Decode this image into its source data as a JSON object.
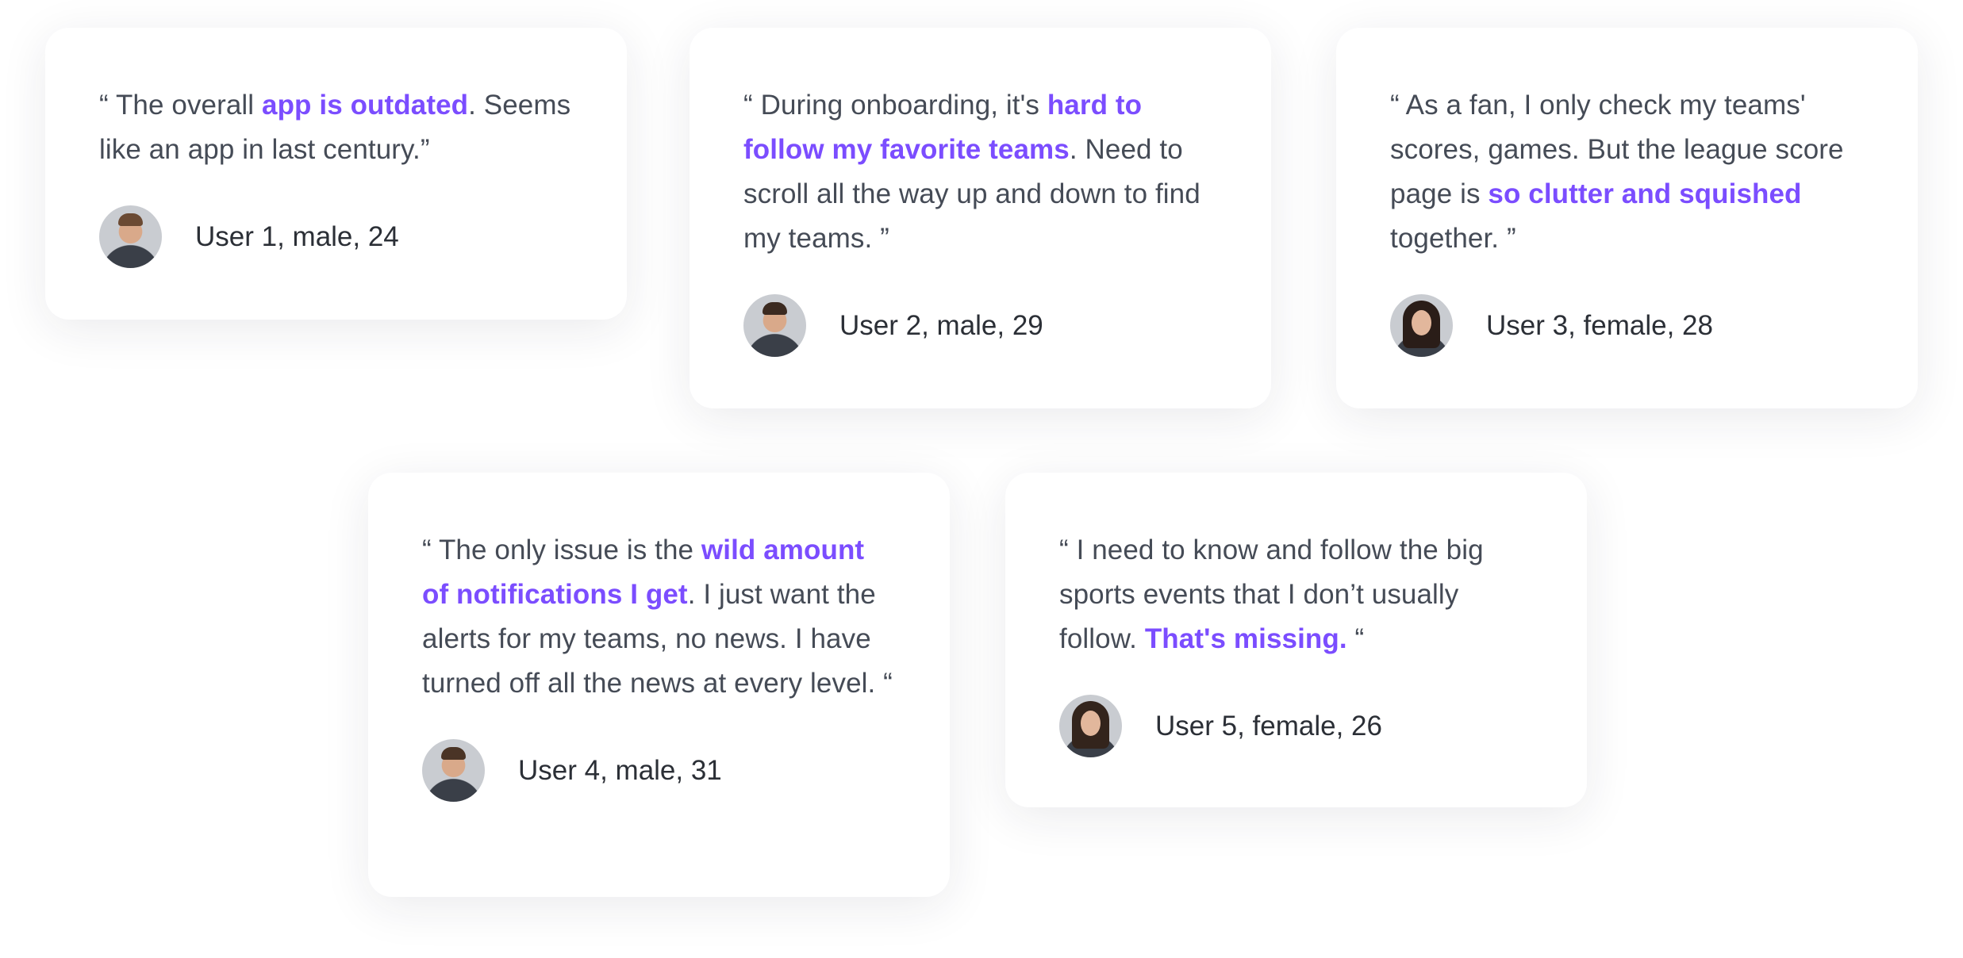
{
  "testimonials": [
    {
      "quote": [
        {
          "text": "“ The overall ",
          "hl": false
        },
        {
          "text": "app is outdated",
          "hl": true
        },
        {
          "text": ". Seems like an app in last century.”",
          "hl": false
        }
      ],
      "author": "User 1, male, 24"
    },
    {
      "quote": [
        {
          "text": "“ During onboarding, it's ",
          "hl": false
        },
        {
          "text": "hard to follow my favorite teams",
          "hl": true
        },
        {
          "text": ". Need to scroll all the way up and down to find my teams. ”",
          "hl": false
        }
      ],
      "author": "User 2, male, 29"
    },
    {
      "quote": [
        {
          "text": "“ As a fan, I only check my teams' scores, games. But the league score page is ",
          "hl": false
        },
        {
          "text": "so clutter and squished",
          "hl": true
        },
        {
          "text": " together. ”",
          "hl": false
        }
      ],
      "author": "User 3, female, 28"
    },
    {
      "quote": [
        {
          "text": "“ The only issue is the ",
          "hl": false
        },
        {
          "text": "wild amount of notifications I get",
          "hl": true
        },
        {
          "text": ". I just want the alerts for my teams, no news. I have turned off all the news at every level. “",
          "hl": false
        }
      ],
      "author": "User 4, male, 31"
    },
    {
      "quote": [
        {
          "text": "“ I need to know and follow the big sports events that I don’t usually follow. ",
          "hl": false
        },
        {
          "text": "That's missing.",
          "hl": true
        },
        {
          "text": " “",
          "hl": false
        }
      ],
      "author": "User 5, female, 26"
    }
  ],
  "colors": {
    "highlight": "#7b4dff",
    "text": "#454b56"
  }
}
